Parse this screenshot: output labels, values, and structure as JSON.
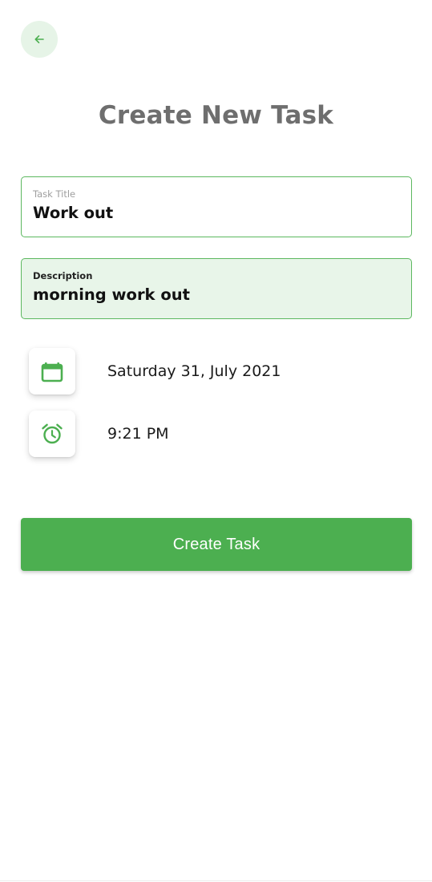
{
  "header": {
    "title": "Create New Task",
    "back_icon": "arrow-left-icon"
  },
  "form": {
    "task_title": {
      "label": "Task Title",
      "value": "Work out"
    },
    "description": {
      "label": "Description",
      "value": "morning work out"
    },
    "date": {
      "icon": "calendar-icon",
      "value": "Saturday 31, July 2021"
    },
    "time": {
      "icon": "alarm-clock-icon",
      "value": "9:21 PM"
    }
  },
  "actions": {
    "create_label": "Create Task"
  },
  "colors": {
    "accent": "#4caf50",
    "accent_light": "#e8f5e9",
    "title_gray": "#6e6e6e"
  }
}
